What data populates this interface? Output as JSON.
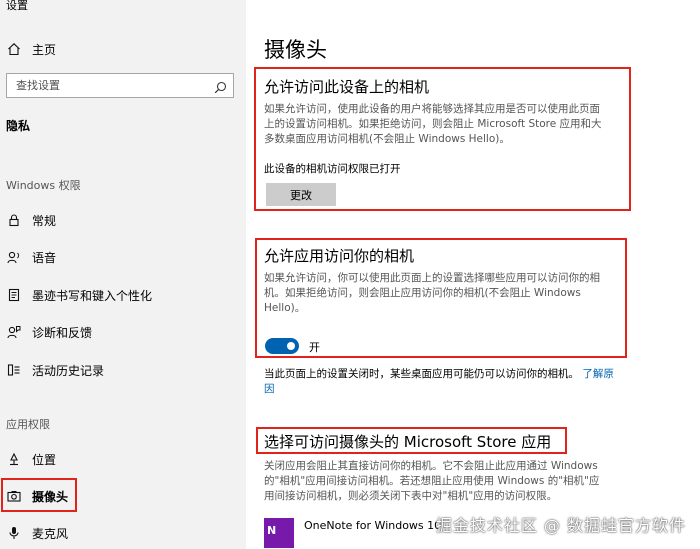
{
  "app": {
    "title": "设置"
  },
  "sidebar": {
    "home": "主页",
    "search_placeholder": "查找设置",
    "section": "隐私",
    "group_windows": "Windows 权限",
    "windows_items": [
      {
        "label": "常规",
        "icon": "lock-icon"
      },
      {
        "label": "语音",
        "icon": "speech-icon"
      },
      {
        "label": "墨迹书写和键入个性化",
        "icon": "inking-icon"
      },
      {
        "label": "诊断和反馈",
        "icon": "feedback-icon"
      },
      {
        "label": "活动历史记录",
        "icon": "history-icon"
      }
    ],
    "group_app": "应用权限",
    "app_items": [
      {
        "label": "位置",
        "icon": "location-icon"
      },
      {
        "label": "摄像头",
        "icon": "camera-icon",
        "selected": true
      },
      {
        "label": "麦克风",
        "icon": "microphone-icon"
      }
    ]
  },
  "main": {
    "title": "摄像头",
    "section1": {
      "heading": "允许访问此设备上的相机",
      "desc_lines": [
        "如果允许访问，使用此设备的用户将能够选择其应用是否可以使用此页面",
        "上的设置访问相机。如果拒绝访问，则会阻止 Microsoft Store 应用和大",
        "多数桌面应用访问相机(不会阻止 Windows Hello)。"
      ],
      "status": "此设备的相机访问权限已打开",
      "button": "更改"
    },
    "section2": {
      "heading": "允许应用访问你的相机",
      "desc_lines": [
        "如果允许访问，你可以使用此页面上的设置选择哪些应用可以访问你的相",
        "机。如果拒绝访问，则会阻止应用访问你的相机(不会阻止 Windows",
        "Hello)。"
      ],
      "toggle_label": "开",
      "toggle_on": true
    },
    "note": {
      "text": "当此页面上的设置关闭时，某些桌面应用可能仍可以访问你的相机。",
      "link": "了解原因"
    },
    "section3": {
      "heading": "选择可访问摄像头的 Microsoft Store 应用",
      "desc_lines": [
        "关闭应用会阻止其直接访问你的相机。它不会阻止此应用通过 Windows",
        "的\"相机\"应用间接访问相机。若还想阻止应用使用 Windows 的\"相机\"应",
        "用间接访问相机，则必须关闭下表中对\"相机\"应用的访问权限。"
      ]
    },
    "app_row": {
      "icon_text": "N",
      "name": "OneNote for Windows 10"
    }
  },
  "watermark": "掘金技术社区 @ 数据蛙官方软件",
  "colors": {
    "accent": "#0063b1",
    "highlight": "#e0241b",
    "sidebar_bg": "#f2f2f2"
  }
}
